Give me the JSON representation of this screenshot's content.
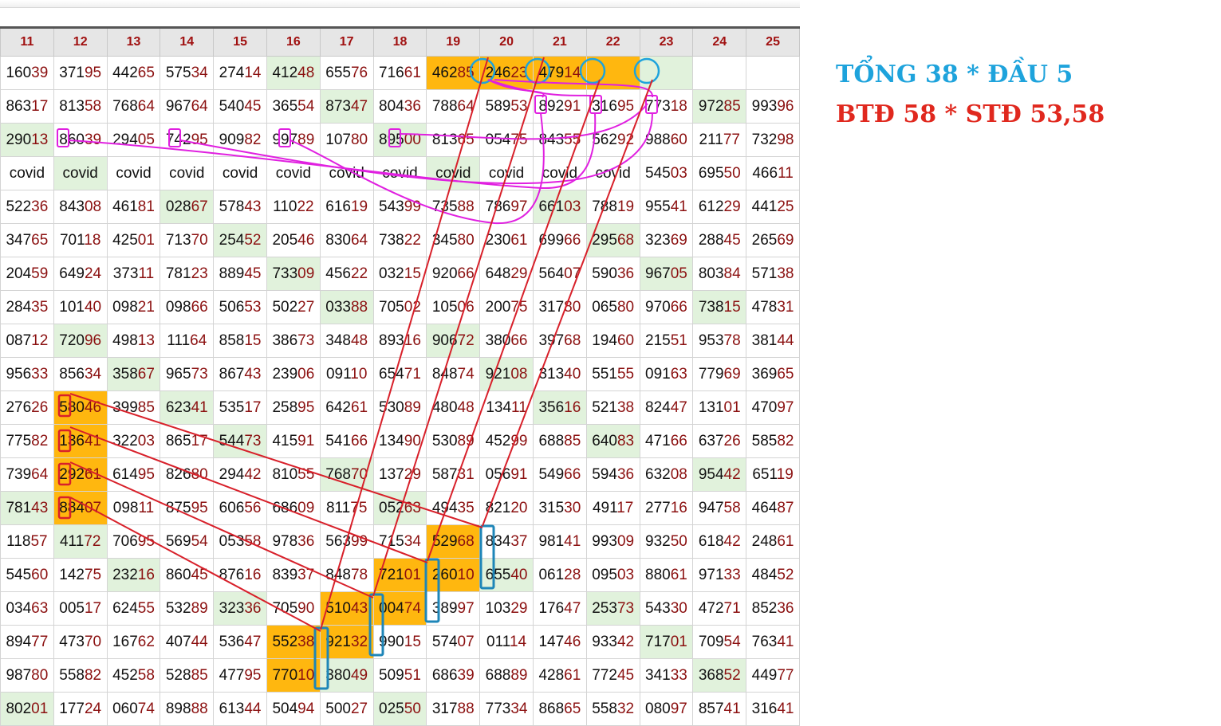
{
  "headers": [
    "11",
    "12",
    "13",
    "14",
    "15",
    "16",
    "17",
    "18",
    "19",
    "20",
    "21",
    "22",
    "23",
    "24",
    "25"
  ],
  "rows": [
    [
      [
        "16039",
        ""
      ],
      [
        "37195",
        ""
      ],
      [
        "44265",
        ""
      ],
      [
        "57534",
        ""
      ],
      [
        "27414",
        ""
      ],
      [
        "41248",
        "g"
      ],
      [
        "65576",
        ""
      ],
      [
        "71661",
        ""
      ],
      [
        "46285",
        "o"
      ],
      [
        "24623",
        "o"
      ],
      [
        "47914",
        "o"
      ],
      [
        "",
        "o"
      ],
      [
        "",
        "g"
      ],
      [
        "",
        ""
      ],
      [
        "",
        ""
      ]
    ],
    [
      [
        "86317",
        ""
      ],
      [
        "81358",
        ""
      ],
      [
        "76864",
        ""
      ],
      [
        "96764",
        ""
      ],
      [
        "54045",
        ""
      ],
      [
        "36554",
        ""
      ],
      [
        "87347",
        "g"
      ],
      [
        "80436",
        ""
      ],
      [
        "78864",
        ""
      ],
      [
        "58953",
        ""
      ],
      [
        "89291",
        ""
      ],
      [
        "31695",
        ""
      ],
      [
        "77318",
        ""
      ],
      [
        "97285",
        "g"
      ],
      [
        "99396",
        ""
      ]
    ],
    [
      [
        "29013",
        "g"
      ],
      [
        "86039",
        ""
      ],
      [
        "29405",
        ""
      ],
      [
        "74295",
        ""
      ],
      [
        "90982",
        ""
      ],
      [
        "99789",
        ""
      ],
      [
        "10780",
        ""
      ],
      [
        "89500",
        "g"
      ],
      [
        "81365",
        ""
      ],
      [
        "05475",
        ""
      ],
      [
        "84355",
        ""
      ],
      [
        "56292",
        ""
      ],
      [
        "98860",
        ""
      ],
      [
        "21177",
        ""
      ],
      [
        "73298",
        ""
      ]
    ],
    [
      [
        "covid",
        ""
      ],
      [
        "covid",
        "g"
      ],
      [
        "covid",
        ""
      ],
      [
        "covid",
        ""
      ],
      [
        "covid",
        ""
      ],
      [
        "covid",
        ""
      ],
      [
        "covid",
        ""
      ],
      [
        "covid",
        ""
      ],
      [
        "covid",
        "g"
      ],
      [
        "covid",
        ""
      ],
      [
        "covid",
        ""
      ],
      [
        "covid",
        ""
      ],
      [
        "54503",
        ""
      ],
      [
        "69550",
        ""
      ],
      [
        "46611",
        ""
      ]
    ],
    [
      [
        "52236",
        ""
      ],
      [
        "84308",
        ""
      ],
      [
        "46181",
        ""
      ],
      [
        "02867",
        "g"
      ],
      [
        "57843",
        ""
      ],
      [
        "11022",
        ""
      ],
      [
        "61619",
        ""
      ],
      [
        "54399",
        ""
      ],
      [
        "73588",
        ""
      ],
      [
        "78697",
        ""
      ],
      [
        "66103",
        "g"
      ],
      [
        "78819",
        ""
      ],
      [
        "95541",
        ""
      ],
      [
        "61229",
        ""
      ],
      [
        "44125",
        ""
      ]
    ],
    [
      [
        "34765",
        ""
      ],
      [
        "70118",
        ""
      ],
      [
        "42501",
        ""
      ],
      [
        "71370",
        ""
      ],
      [
        "25452",
        "g"
      ],
      [
        "20546",
        ""
      ],
      [
        "83064",
        ""
      ],
      [
        "73822",
        ""
      ],
      [
        "34580",
        ""
      ],
      [
        "23061",
        ""
      ],
      [
        "69966",
        ""
      ],
      [
        "29568",
        "g"
      ],
      [
        "32369",
        ""
      ],
      [
        "28845",
        ""
      ],
      [
        "26569",
        ""
      ]
    ],
    [
      [
        "20459",
        ""
      ],
      [
        "64924",
        ""
      ],
      [
        "37311",
        ""
      ],
      [
        "78123",
        ""
      ],
      [
        "88945",
        ""
      ],
      [
        "73309",
        "g"
      ],
      [
        "45622",
        ""
      ],
      [
        "03215",
        ""
      ],
      [
        "92066",
        ""
      ],
      [
        "64829",
        ""
      ],
      [
        "56407",
        ""
      ],
      [
        "59036",
        ""
      ],
      [
        "96705",
        "g"
      ],
      [
        "80384",
        ""
      ],
      [
        "57138",
        ""
      ]
    ],
    [
      [
        "28435",
        ""
      ],
      [
        "10140",
        ""
      ],
      [
        "09821",
        ""
      ],
      [
        "09866",
        ""
      ],
      [
        "50653",
        ""
      ],
      [
        "50227",
        ""
      ],
      [
        "03388",
        "g"
      ],
      [
        "70502",
        ""
      ],
      [
        "10506",
        ""
      ],
      [
        "20075",
        ""
      ],
      [
        "31780",
        ""
      ],
      [
        "06580",
        ""
      ],
      [
        "97066",
        ""
      ],
      [
        "73815",
        "g"
      ],
      [
        "47831",
        ""
      ]
    ],
    [
      [
        "08712",
        ""
      ],
      [
        "72096",
        "g"
      ],
      [
        "49813",
        ""
      ],
      [
        "11164",
        ""
      ],
      [
        "85815",
        ""
      ],
      [
        "38673",
        ""
      ],
      [
        "34848",
        ""
      ],
      [
        "89316",
        ""
      ],
      [
        "90672",
        "g"
      ],
      [
        "38066",
        ""
      ],
      [
        "39768",
        ""
      ],
      [
        "19460",
        ""
      ],
      [
        "21551",
        ""
      ],
      [
        "95378",
        ""
      ],
      [
        "38144",
        ""
      ]
    ],
    [
      [
        "95633",
        ""
      ],
      [
        "85634",
        ""
      ],
      [
        "35867",
        "g"
      ],
      [
        "96573",
        ""
      ],
      [
        "86743",
        ""
      ],
      [
        "23906",
        ""
      ],
      [
        "09110",
        ""
      ],
      [
        "65471",
        ""
      ],
      [
        "84874",
        ""
      ],
      [
        "92108",
        "g"
      ],
      [
        "31340",
        ""
      ],
      [
        "55155",
        ""
      ],
      [
        "09163",
        ""
      ],
      [
        "77969",
        ""
      ],
      [
        "36965",
        ""
      ]
    ],
    [
      [
        "27626",
        ""
      ],
      [
        "58046",
        "o"
      ],
      [
        "39985",
        ""
      ],
      [
        "62341",
        "g"
      ],
      [
        "53517",
        ""
      ],
      [
        "25895",
        ""
      ],
      [
        "64261",
        ""
      ],
      [
        "53089",
        ""
      ],
      [
        "48048",
        ""
      ],
      [
        "13411",
        ""
      ],
      [
        "35616",
        "g"
      ],
      [
        "52138",
        ""
      ],
      [
        "82447",
        ""
      ],
      [
        "13101",
        ""
      ],
      [
        "47097",
        ""
      ]
    ],
    [
      [
        "77582",
        ""
      ],
      [
        "13641",
        "o"
      ],
      [
        "32203",
        ""
      ],
      [
        "86517",
        ""
      ],
      [
        "54473",
        "g"
      ],
      [
        "41591",
        ""
      ],
      [
        "54166",
        ""
      ],
      [
        "13490",
        ""
      ],
      [
        "53089",
        ""
      ],
      [
        "45299",
        ""
      ],
      [
        "68885",
        ""
      ],
      [
        "64083",
        "g"
      ],
      [
        "47166",
        ""
      ],
      [
        "63726",
        ""
      ],
      [
        "58582",
        ""
      ]
    ],
    [
      [
        "73964",
        ""
      ],
      [
        "29261",
        "o"
      ],
      [
        "61495",
        ""
      ],
      [
        "82680",
        ""
      ],
      [
        "29442",
        ""
      ],
      [
        "81055",
        ""
      ],
      [
        "76870",
        "g"
      ],
      [
        "13729",
        ""
      ],
      [
        "58731",
        ""
      ],
      [
        "05691",
        ""
      ],
      [
        "54966",
        ""
      ],
      [
        "59436",
        ""
      ],
      [
        "63208",
        ""
      ],
      [
        "95442",
        "g"
      ],
      [
        "65119",
        ""
      ]
    ],
    [
      [
        "78143",
        "g"
      ],
      [
        "88407",
        "o"
      ],
      [
        "09811",
        ""
      ],
      [
        "87595",
        ""
      ],
      [
        "60656",
        ""
      ],
      [
        "68609",
        ""
      ],
      [
        "81175",
        ""
      ],
      [
        "05263",
        "g"
      ],
      [
        "49435",
        ""
      ],
      [
        "82120",
        ""
      ],
      [
        "31530",
        ""
      ],
      [
        "49117",
        ""
      ],
      [
        "27716",
        ""
      ],
      [
        "94758",
        ""
      ],
      [
        "46487",
        ""
      ]
    ],
    [
      [
        "11857",
        ""
      ],
      [
        "41172",
        "g"
      ],
      [
        "70695",
        ""
      ],
      [
        "56954",
        ""
      ],
      [
        "05358",
        ""
      ],
      [
        "97836",
        ""
      ],
      [
        "56399",
        ""
      ],
      [
        "71534",
        ""
      ],
      [
        "52968",
        "o"
      ],
      [
        "83437",
        ""
      ],
      [
        "98141",
        ""
      ],
      [
        "99309",
        ""
      ],
      [
        "93250",
        ""
      ],
      [
        "61842",
        ""
      ],
      [
        "24861",
        ""
      ]
    ],
    [
      [
        "54560",
        ""
      ],
      [
        "14275",
        ""
      ],
      [
        "23216",
        "g"
      ],
      [
        "86045",
        ""
      ],
      [
        "87616",
        ""
      ],
      [
        "83937",
        ""
      ],
      [
        "84878",
        ""
      ],
      [
        "72101",
        "o"
      ],
      [
        "26010",
        "o"
      ],
      [
        "65540",
        "g"
      ],
      [
        "06128",
        ""
      ],
      [
        "09503",
        ""
      ],
      [
        "88061",
        ""
      ],
      [
        "97133",
        ""
      ],
      [
        "48452",
        ""
      ]
    ],
    [
      [
        "03463",
        ""
      ],
      [
        "00517",
        ""
      ],
      [
        "62455",
        ""
      ],
      [
        "53289",
        ""
      ],
      [
        "32336",
        "g"
      ],
      [
        "70590",
        ""
      ],
      [
        "51043",
        "o"
      ],
      [
        "00474",
        "o"
      ],
      [
        "38997",
        ""
      ],
      [
        "10329",
        ""
      ],
      [
        "17647",
        ""
      ],
      [
        "25373",
        "g"
      ],
      [
        "54330",
        ""
      ],
      [
        "47271",
        ""
      ],
      [
        "85236",
        ""
      ]
    ],
    [
      [
        "89477",
        ""
      ],
      [
        "47370",
        ""
      ],
      [
        "16762",
        ""
      ],
      [
        "40744",
        ""
      ],
      [
        "53647",
        ""
      ],
      [
        "55238",
        "o"
      ],
      [
        "92132",
        "o"
      ],
      [
        "99015",
        ""
      ],
      [
        "57407",
        ""
      ],
      [
        "01114",
        ""
      ],
      [
        "14746",
        ""
      ],
      [
        "93342",
        ""
      ],
      [
        "71701",
        "g"
      ],
      [
        "70954",
        ""
      ],
      [
        "76341",
        ""
      ]
    ],
    [
      [
        "98780",
        ""
      ],
      [
        "55882",
        ""
      ],
      [
        "45258",
        ""
      ],
      [
        "52885",
        ""
      ],
      [
        "47795",
        ""
      ],
      [
        "77010",
        "o"
      ],
      [
        "38049",
        "g"
      ],
      [
        "50951",
        ""
      ],
      [
        "68639",
        ""
      ],
      [
        "68889",
        ""
      ],
      [
        "42861",
        ""
      ],
      [
        "77245",
        ""
      ],
      [
        "34133",
        ""
      ],
      [
        "36852",
        "g"
      ],
      [
        "44977",
        ""
      ]
    ],
    [
      [
        "80201",
        "g"
      ],
      [
        "17724",
        ""
      ],
      [
        "06074",
        ""
      ],
      [
        "89888",
        ""
      ],
      [
        "61344",
        ""
      ],
      [
        "50494",
        ""
      ],
      [
        "50027",
        ""
      ],
      [
        "02550",
        "g"
      ],
      [
        "31788",
        ""
      ],
      [
        "77334",
        ""
      ],
      [
        "86865",
        ""
      ],
      [
        "55832",
        ""
      ],
      [
        "08097",
        ""
      ],
      [
        "85741",
        ""
      ],
      [
        "31641",
        ""
      ]
    ]
  ],
  "notes": {
    "line1": "TỔNG 38 * ĐẦU 5",
    "line2": "BTĐ 58 * STĐ 53,58"
  },
  "colors": {
    "highlight": "#ffb70f",
    "green_cell": "#e1f2dc",
    "circle": "#1ea3dc",
    "magenta": "#e020e0",
    "red_line": "#d8202a",
    "note_blue": "#1ea3dc",
    "note_red": "#e0281e"
  }
}
